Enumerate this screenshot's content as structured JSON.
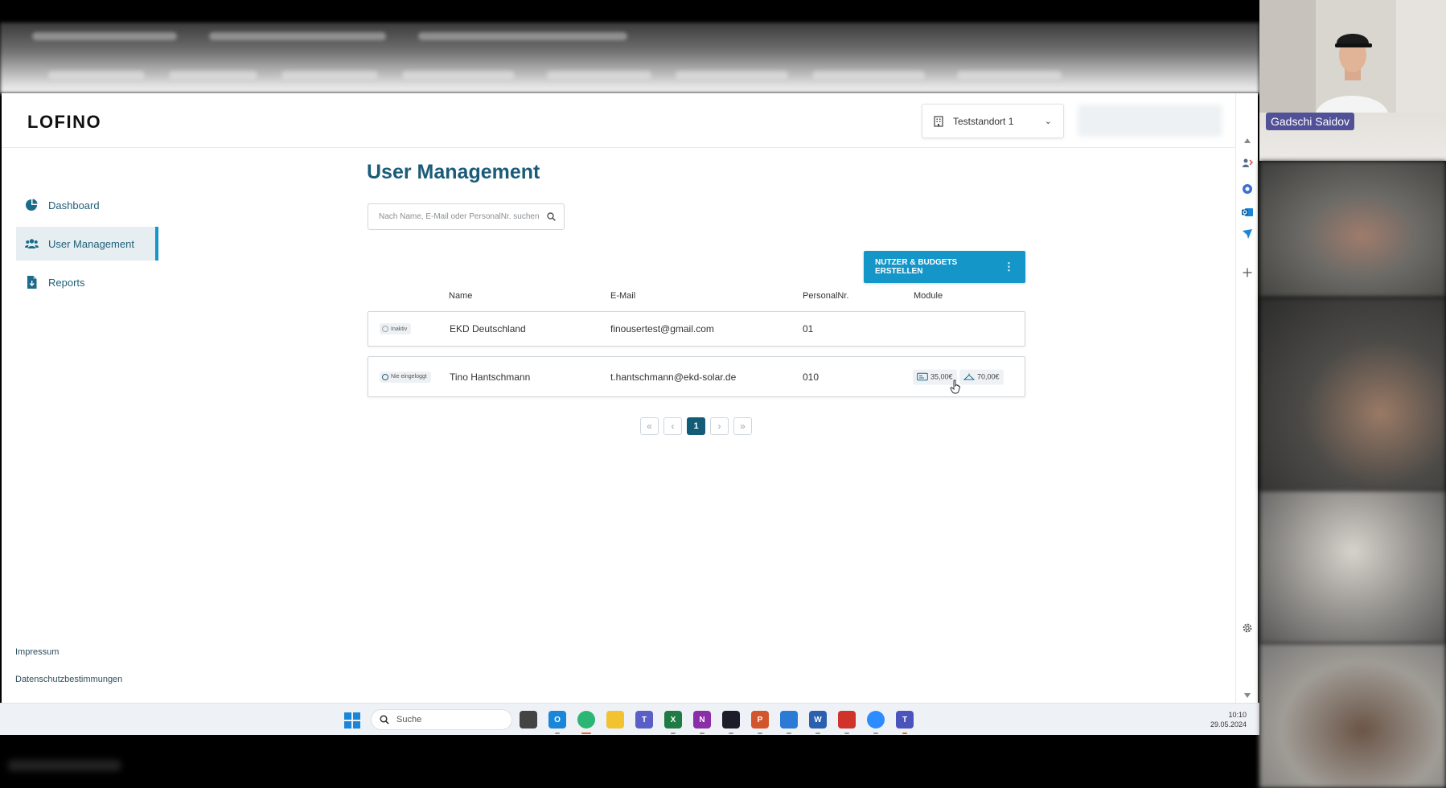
{
  "app": {
    "logo": "LOFINO",
    "location": "Teststandort 1"
  },
  "sidebar": {
    "items": [
      {
        "label": "Dashboard",
        "icon": "pie-chart-icon"
      },
      {
        "label": "User Management",
        "icon": "users-icon",
        "active": true
      },
      {
        "label": "Reports",
        "icon": "report-file-icon"
      }
    ],
    "footer": [
      "Impressum",
      "Datenschutzbestimmungen"
    ]
  },
  "main": {
    "title": "User Management",
    "search_placeholder": "Nach Name, E-Mail oder PersonalNr. suchen",
    "create_button": "NUTZER & BUDGETS ERSTELLEN",
    "columns": [
      "Name",
      "E-Mail",
      "PersonalNr.",
      "Module"
    ],
    "rows": [
      {
        "status": "Inaktiv",
        "name": "EKD Deutschland",
        "email": "finousertest@gmail.com",
        "personal_nr": "01",
        "modules": []
      },
      {
        "status": "Nie eingeloggt",
        "name": "Tino Hantschmann",
        "email": "t.hantschmann@ekd-solar.de",
        "personal_nr": "010",
        "modules": [
          {
            "icon": "meal-card-icon",
            "value": "35,00€"
          },
          {
            "icon": "clothes-hanger-icon",
            "value": "70,00€"
          }
        ]
      }
    ],
    "pagination": {
      "first": "«",
      "prev": "‹",
      "current": "1",
      "next": "›",
      "last": "»"
    }
  },
  "taskbar": {
    "search_label": "Suche",
    "time": "10:10",
    "date": "29.05.2024"
  },
  "meeting": {
    "participant_name": "Gadschi Saidov"
  },
  "colors": {
    "primary": "#1596c8",
    "heading": "#1a5c78",
    "page_current": "#125c78"
  }
}
